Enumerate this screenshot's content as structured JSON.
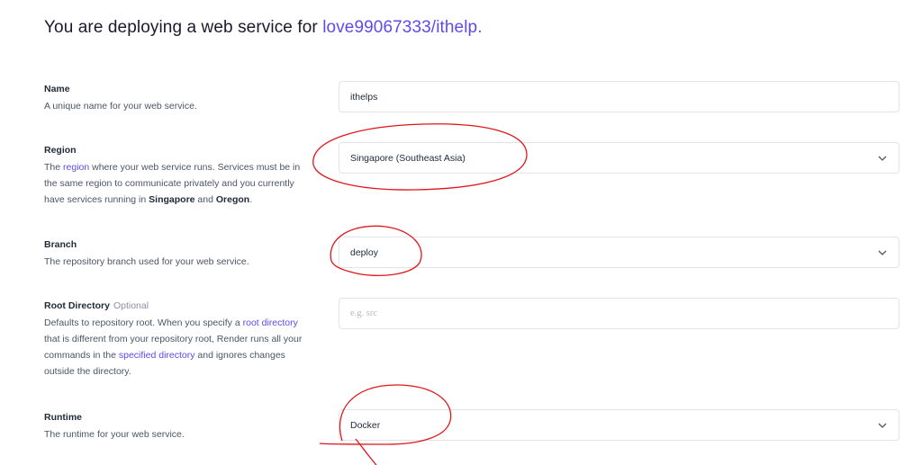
{
  "header": {
    "title_prefix": "You are deploying a web service for",
    "repo": "love99067333/ithelp."
  },
  "fields": {
    "name": {
      "label": "Name",
      "description": "A unique name for your web service.",
      "value": "ithelps"
    },
    "region": {
      "label": "Region",
      "desc_part1": "The ",
      "desc_link": "region",
      "desc_part2": " where your web service runs. Services must be in the same region to communicate privately and you currently have services running in ",
      "desc_bold1": "Singapore",
      "desc_and": " and ",
      "desc_bold2": "Oregon",
      "desc_end": ".",
      "value": "Singapore (Southeast Asia)"
    },
    "branch": {
      "label": "Branch",
      "description": "The repository branch used for your web service.",
      "value": "deploy"
    },
    "root_directory": {
      "label": "Root Directory",
      "optional": "Optional",
      "desc_part1": "Defaults to repository root. When you specify a ",
      "desc_link1": "root directory",
      "desc_part2": " that is different from your repository root, Render runs all your commands in the ",
      "desc_link2": "specified directory",
      "desc_part3": " and ignores changes outside the directory.",
      "placeholder": "e.g. src"
    },
    "runtime": {
      "label": "Runtime",
      "description": "The runtime for your web service.",
      "value": "Docker"
    }
  },
  "colors": {
    "accent": "#5b4bf0",
    "annotation": "#e0161b",
    "border": "#e3e4e8"
  },
  "icons": {
    "dropdown": "chevron-down-icon"
  }
}
